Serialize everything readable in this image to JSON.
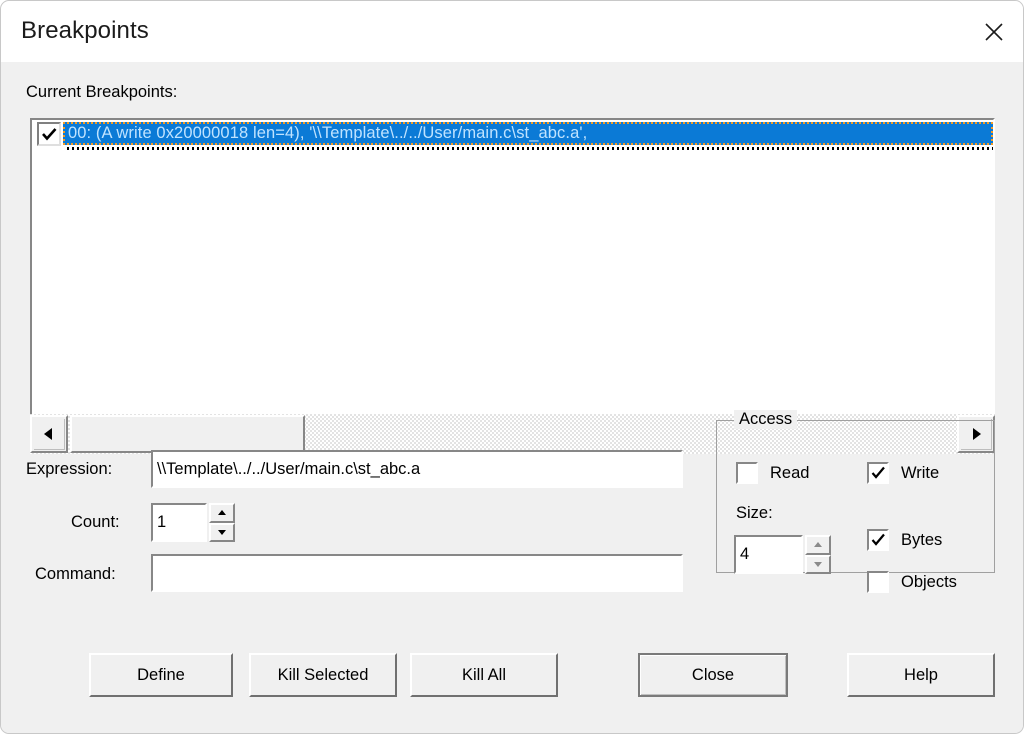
{
  "window": {
    "title": "Breakpoints",
    "close_icon": "close-icon"
  },
  "list_section": {
    "label": "Current Breakpoints:",
    "items": [
      {
        "checked": true,
        "text": "00: (A write 0x20000018 len=4),  '\\\\Template\\../../User/main.c\\st_abc.a',"
      }
    ],
    "scrollbar": {
      "left_arrow": "triangle-left-icon",
      "right_arrow": "triangle-right-icon"
    }
  },
  "form": {
    "expression": {
      "label": "Expression:",
      "value": "\\\\Template\\../../User/main.c\\st_abc.a",
      "placeholder": ""
    },
    "count": {
      "label": "Count:",
      "value": "1",
      "up_icon": "spin-up-icon",
      "down_icon": "spin-down-icon"
    },
    "command": {
      "label": "Command:",
      "value": "",
      "placeholder": ""
    }
  },
  "access": {
    "legend": "Access",
    "read": {
      "label": "Read",
      "checked": false
    },
    "write": {
      "label": "Write",
      "checked": true
    },
    "size": {
      "label": "Size:",
      "value": "4",
      "up_icon": "spin-up-icon",
      "down_icon": "spin-down-icon"
    },
    "bytes": {
      "label": "Bytes",
      "checked": true
    },
    "objects": {
      "label": "Objects",
      "checked": false
    }
  },
  "buttons": {
    "define": "Define",
    "kill_selected": "Kill Selected",
    "kill_all": "Kill All",
    "close": "Close",
    "help": "Help"
  },
  "colors": {
    "dialog_background": "#f0f0f0",
    "titlebar_background": "#ffffff",
    "selection_blue": "#0b7ad6",
    "selection_text": "#bfe3ff",
    "focus_rect": "#f59b23",
    "field_background": "#ffffff",
    "text": "#000000"
  }
}
